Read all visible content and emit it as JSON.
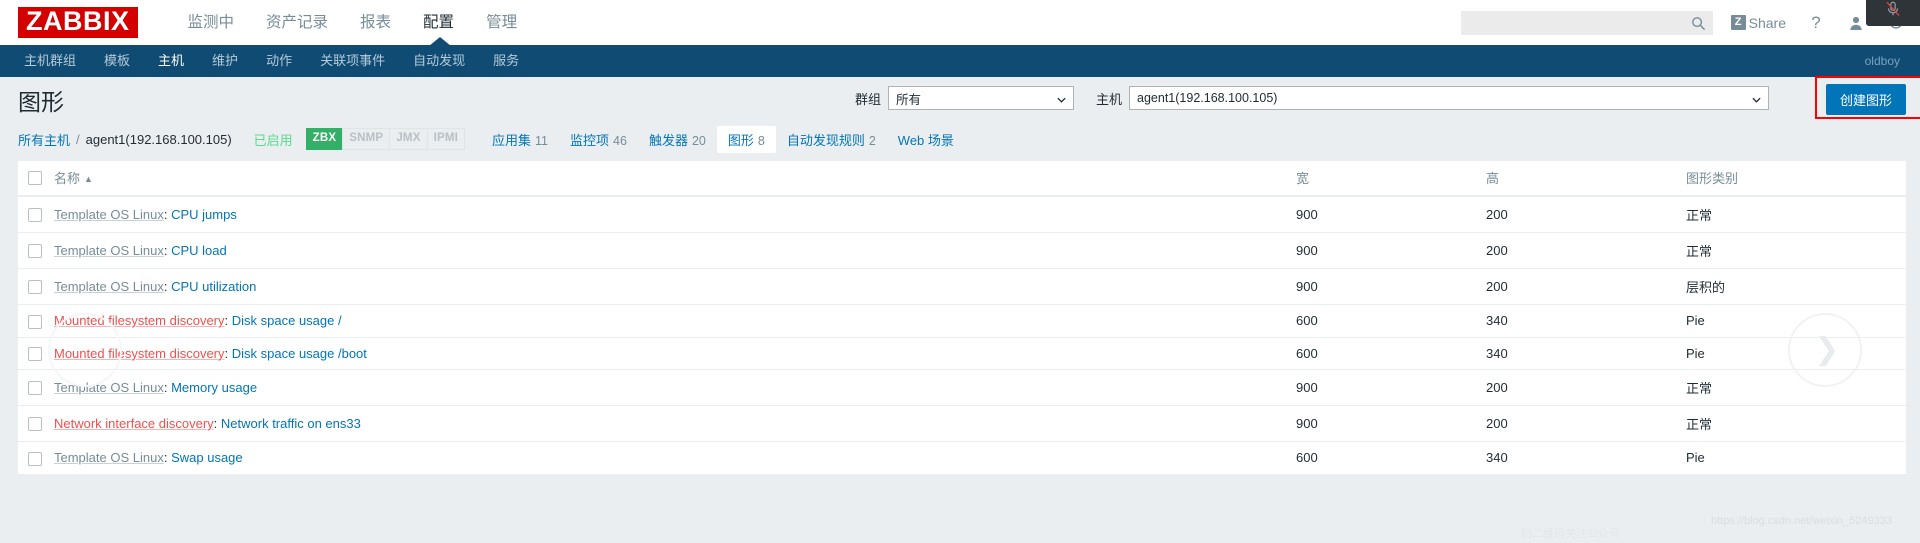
{
  "header": {
    "logo": "ZABBIX",
    "menu": [
      {
        "label": "监测中",
        "selected": false
      },
      {
        "label": "资产记录",
        "selected": false
      },
      {
        "label": "报表",
        "selected": false
      },
      {
        "label": "配置",
        "selected": true
      },
      {
        "label": "管理",
        "selected": false
      }
    ],
    "search": {
      "value": "",
      "placeholder": ""
    },
    "share_badge": "Z",
    "share_label": "Share",
    "help_icon": "?",
    "user_icon": "user-icon",
    "signout_icon": "power-icon"
  },
  "subnav": {
    "items": [
      {
        "label": "主机群组",
        "selected": false
      },
      {
        "label": "模板",
        "selected": false
      },
      {
        "label": "主机",
        "selected": true
      },
      {
        "label": "维护",
        "selected": false
      },
      {
        "label": "动作",
        "selected": false
      },
      {
        "label": "关联项事件",
        "selected": false
      },
      {
        "label": "自动发现",
        "selected": false
      },
      {
        "label": "服务",
        "selected": false
      }
    ],
    "user": "oldboy"
  },
  "page": {
    "title": "图形",
    "filter": {
      "group_label": "群组",
      "group_value": "所有",
      "host_label": "主机",
      "host_value": "agent1(192.168.100.105)"
    },
    "create_button": "创建图形"
  },
  "breadcrumb": {
    "all_hosts": "所有主机",
    "separator": "/",
    "host": "agent1(192.168.100.105)",
    "status": "已启用",
    "interfaces": [
      {
        "label": "ZBX",
        "active": true
      },
      {
        "label": "SNMP",
        "active": false
      },
      {
        "label": "JMX",
        "active": false
      },
      {
        "label": "IPMI",
        "active": false
      }
    ],
    "tabs": [
      {
        "label": "应用集",
        "count": "11",
        "selected": false
      },
      {
        "label": "监控项",
        "count": "46",
        "selected": false
      },
      {
        "label": "触发器",
        "count": "20",
        "selected": false
      },
      {
        "label": "图形",
        "count": "8",
        "selected": true
      },
      {
        "label": "自动发现规则",
        "count": "2",
        "selected": false
      },
      {
        "label": "Web 场景",
        "count": "",
        "selected": false
      }
    ]
  },
  "table": {
    "columns": {
      "name": "名称",
      "sort_arrow": "▲",
      "width": "宽",
      "height": "高",
      "type": "图形类别"
    },
    "rows": [
      {
        "prefix": "Template OS Linux",
        "prefix_kind": "template",
        "name": "CPU jumps",
        "width": "900",
        "height": "200",
        "type": "正常"
      },
      {
        "prefix": "Template OS Linux",
        "prefix_kind": "template",
        "name": "CPU load",
        "width": "900",
        "height": "200",
        "type": "正常"
      },
      {
        "prefix": "Template OS Linux",
        "prefix_kind": "template",
        "name": "CPU utilization",
        "width": "900",
        "height": "200",
        "type": "层积的"
      },
      {
        "prefix": "Mounted filesystem discovery",
        "prefix_kind": "discovery",
        "name": "Disk space usage /",
        "width": "600",
        "height": "340",
        "type": "Pie"
      },
      {
        "prefix": "Mounted filesystem discovery",
        "prefix_kind": "discovery",
        "name": "Disk space usage /boot",
        "width": "600",
        "height": "340",
        "type": "Pie"
      },
      {
        "prefix": "Template OS Linux",
        "prefix_kind": "template",
        "name": "Memory usage",
        "width": "900",
        "height": "200",
        "type": "正常"
      },
      {
        "prefix": "Network interface discovery",
        "prefix_kind": "discovery",
        "name": "Network traffic on ens33",
        "width": "900",
        "height": "200",
        "type": "正常"
      },
      {
        "prefix": "Template OS Linux",
        "prefix_kind": "template",
        "name": "Swap usage",
        "width": "600",
        "height": "340",
        "type": "Pie"
      }
    ]
  },
  "watermark": {
    "url": "https://blog.csdn.net/weixin_5249333",
    "note": "扫二维码关注公众号"
  },
  "colors": {
    "brand_red": "#d40000",
    "nav_blue": "#0f4b73",
    "link_blue": "#0275b8",
    "discovery_orange": "#f24f4f",
    "enabled_green": "#59db8f",
    "zbx_green": "#34af67",
    "highlight_red": "#fe0000"
  }
}
